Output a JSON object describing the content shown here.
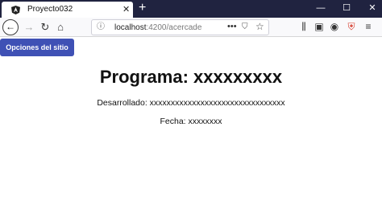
{
  "browser": {
    "tab": {
      "title": "Proyecto032",
      "icon": "angular-icon"
    },
    "address": {
      "host": "localhost",
      "path": ":4200/acercade"
    },
    "colors": {
      "titlebar": "#202340",
      "accent": "#3f51b5"
    }
  },
  "page": {
    "menu_button": "Opciones del sitio",
    "heading": "Programa: xxxxxxxxx",
    "developer": "Desarrollado: xxxxxxxxxxxxxxxxxxxxxxxxxxxxxxxx",
    "date": "Fecha: xxxxxxxx"
  }
}
